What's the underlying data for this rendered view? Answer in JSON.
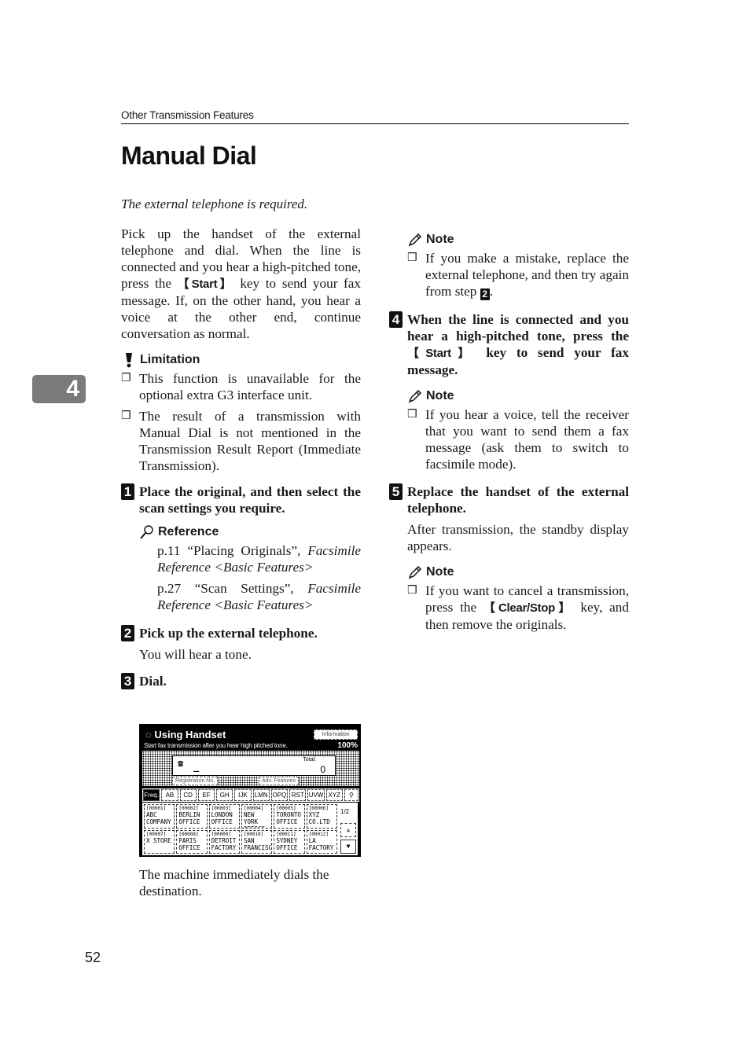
{
  "header": {
    "running_head": "Other Transmission Features"
  },
  "title": "Manual Dial",
  "subtitle": "The external telephone is required.",
  "chapter_tab": "4",
  "intro": {
    "before_key": "Pick up the handset of the external telephone and dial. When the line is connected and you hear a high-pitched tone, press the ",
    "key": "【Start】",
    "after_key": " key to send your fax message. If, on the other hand, you hear a voice at the other end, continue conversation as normal."
  },
  "limitation": {
    "heading": "Limitation",
    "items": [
      "This function is unavailable for the optional extra G3 interface unit.",
      "The result of a transmission with Manual Dial is not mentioned in the Transmission Result Report (Immediate Transmission)."
    ]
  },
  "steps": [
    {
      "num": "1",
      "text": "Place the original, and then select the scan settings you require.",
      "reference": {
        "heading": "Reference",
        "items": [
          {
            "page": "p.11 “Placing Originals”, ",
            "book": "Facsimile Reference <Basic Features>"
          },
          {
            "page": "p.27 “Scan Settings”, ",
            "book": "Facsimile Reference <Basic Features>"
          }
        ]
      }
    },
    {
      "num": "2",
      "text": "Pick up the external telephone.",
      "body": "You will hear a tone."
    },
    {
      "num": "3",
      "text": "Dial.",
      "body": "The machine immediately dials the destination."
    },
    {
      "num": "4",
      "text_before": "When the line is connected and you hear a high-pitched tone, press the ",
      "key": "【Start】",
      "text_after": " key to send your fax message.",
      "note": {
        "heading": "Note",
        "item": "If you hear a voice, tell the receiver that you want to send them a fax message (ask them to switch to facsimile mode)."
      }
    },
    {
      "num": "5",
      "text": "Replace the handset of the external telephone.",
      "body": "After transmission, the standby display appears.",
      "note": {
        "heading": "Note",
        "before_key": "If you want to cancel a transmission, press the ",
        "key": "【Clear/Stop】",
        "after_key": " key, and then remove the originals."
      }
    }
  ],
  "note_top": {
    "heading": "Note",
    "item_before": "If you make a mistake, replace the external telephone, and then try again from step ",
    "step_ref": "2",
    "item_after": "."
  },
  "lcd": {
    "title": "◌ Using Handset",
    "message": "Start fax transmission after you hear high pitched tone.",
    "info_button": "Information",
    "counter": "100%",
    "phone_icon": "☎",
    "cursor": "_",
    "total_label": "Total:",
    "total_value": "0",
    "registration_button": "Registration No.",
    "adv_features_button": "Adv. Features",
    "tabs": [
      "Freq.",
      "AB",
      "CD",
      "EF",
      "GH",
      "IJK",
      "LMN",
      "OPQ",
      "RST",
      "UVW",
      "XYZ"
    ],
    "search_icon": "⚲",
    "destinations": [
      {
        "code": "[00001]",
        "name": "ABC COMPANY"
      },
      {
        "code": "[00002]",
        "name": "BERLIN OFFICE"
      },
      {
        "code": "[00003]",
        "name": "LONDON OFFICE"
      },
      {
        "code": "[00004]",
        "name": "NEW YORK OFFICE"
      },
      {
        "code": "[00005]",
        "name": "TORONTO OFFICE"
      },
      {
        "code": "[00006]",
        "name": "XYZ CO.LTD"
      },
      {
        "code": "[00007]",
        "name": "X STORE"
      },
      {
        "code": "[00008]",
        "name": "PARIS OFFICE"
      },
      {
        "code": "[00009]",
        "name": "DETROIT FACTORY"
      },
      {
        "code": "[00010]",
        "name": "SAN FRANCISCO"
      },
      {
        "code": "[00011]",
        "name": "SYDNEY OFFICE"
      },
      {
        "code": "[00012]",
        "name": "LA FACTORY"
      }
    ],
    "page_indicator": "1/2",
    "up_arrow": "▲",
    "down_arrow": "▼"
  },
  "page_number": "52"
}
